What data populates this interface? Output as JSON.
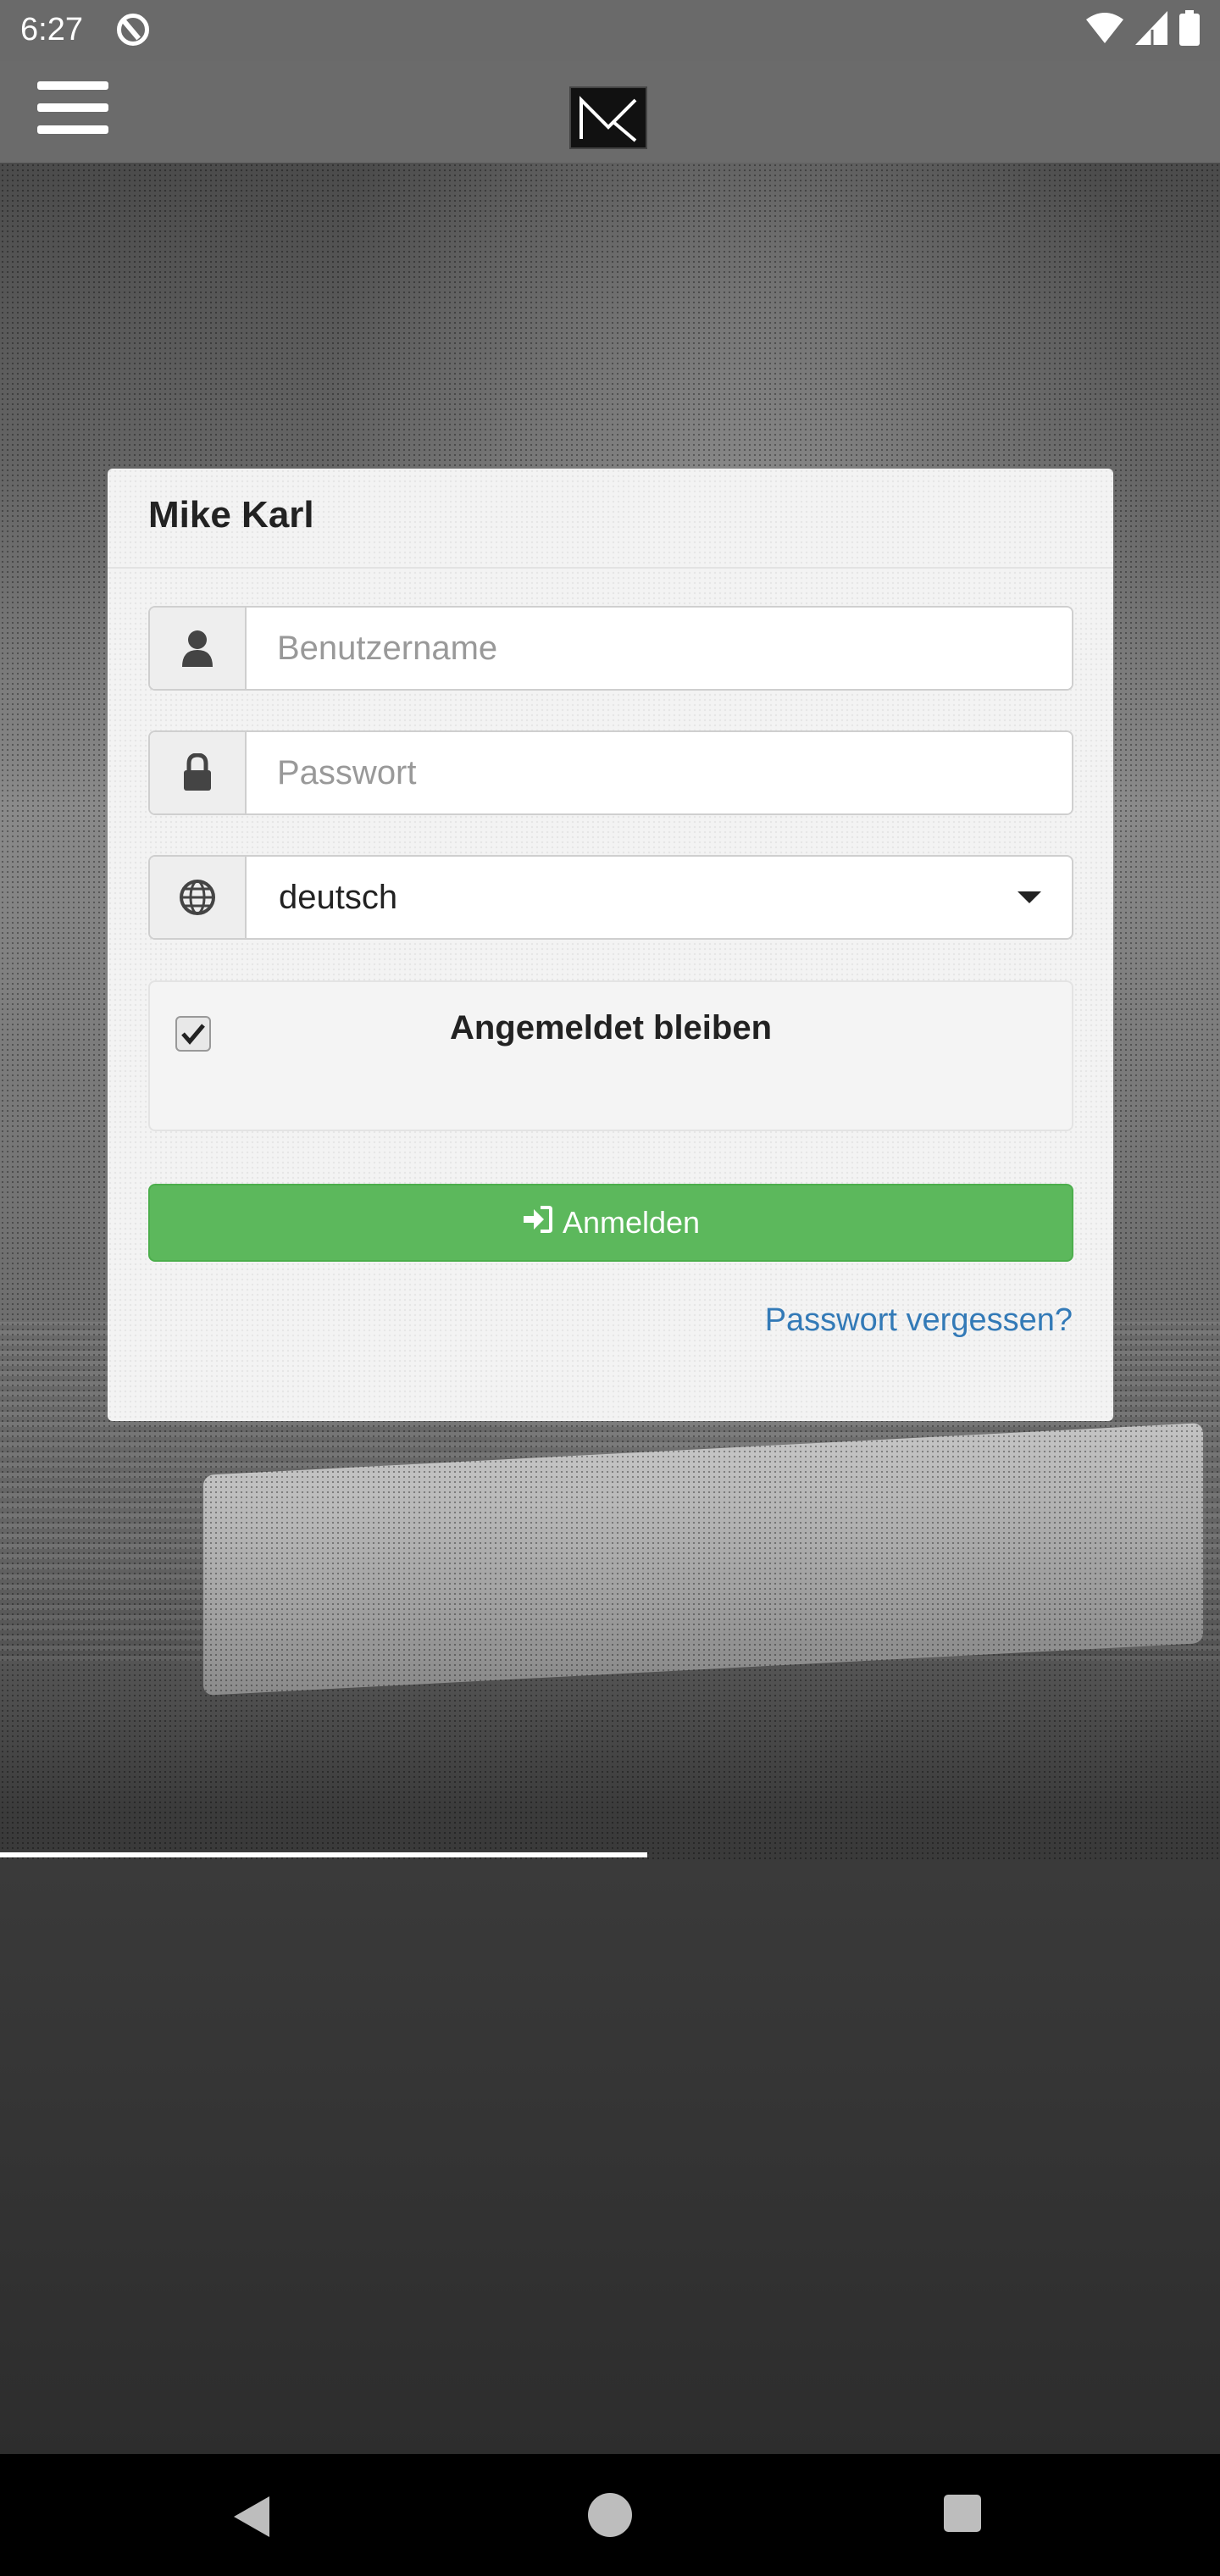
{
  "status_bar": {
    "time": "6:27",
    "icons": [
      "app-notification-icon",
      "wifi-icon",
      "signal-icon",
      "battery-icon"
    ]
  },
  "app_bar": {
    "menu_icon": "hamburger-menu-icon",
    "logo": "MK"
  },
  "login": {
    "title": "Mike Karl",
    "username_placeholder": "Benutzername",
    "password_placeholder": "Passwort",
    "language_selected": "deutsch",
    "remember_label": "Angemeldet bleiben",
    "remember_checked": true,
    "submit_label": "Anmelden",
    "forgot_password": "Passwort vergessen?"
  },
  "colors": {
    "submit_button": "#5cb85c",
    "link": "#337ab7",
    "top_bar": "#6b6b6b"
  },
  "nav_bar": {
    "icons": [
      "back-icon",
      "home-icon",
      "recents-icon"
    ]
  }
}
